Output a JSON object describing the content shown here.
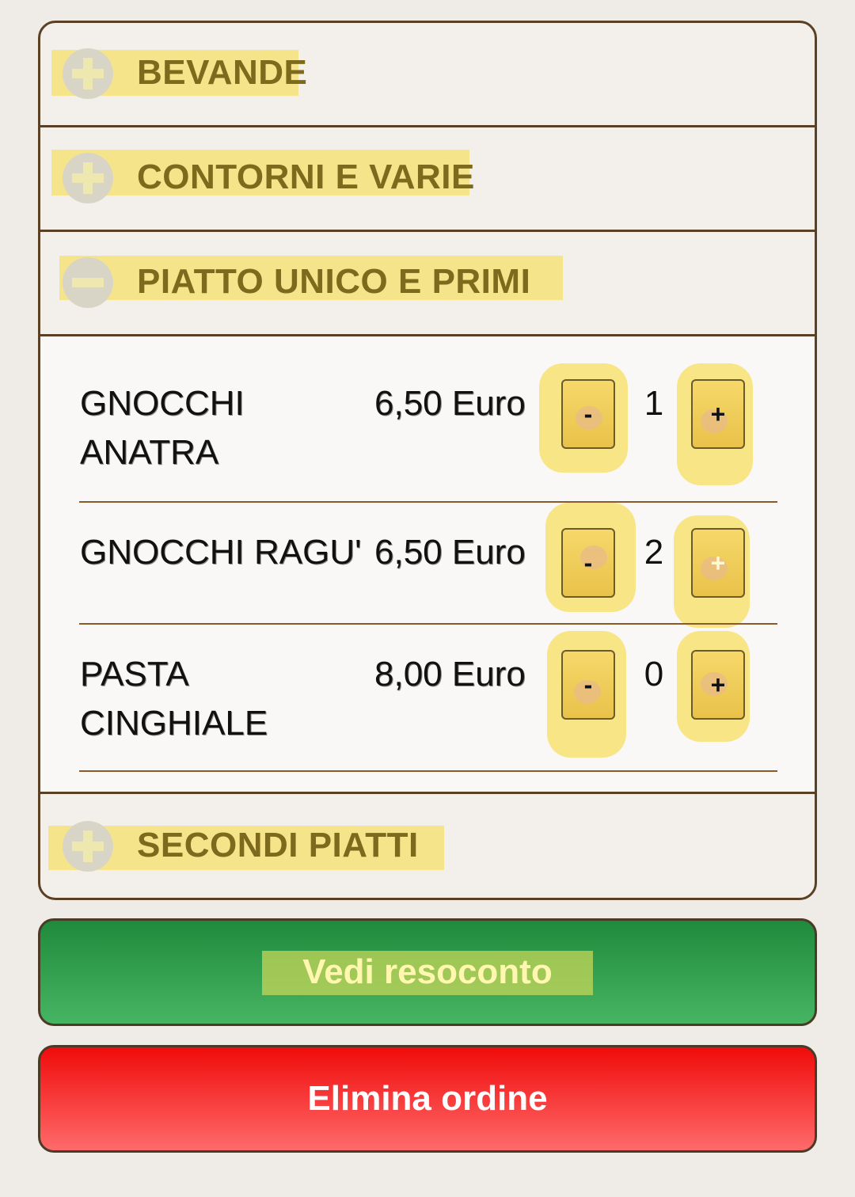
{
  "sections": [
    {
      "title": "BEVANDE",
      "state": "collapsed",
      "icon": "plus-icon"
    },
    {
      "title": "CONTORNI E VARIE",
      "state": "collapsed",
      "icon": "plus-icon"
    },
    {
      "title": "PIATTO UNICO E PRIMI",
      "state": "expanded",
      "icon": "minus-icon"
    },
    {
      "title": "SECONDI PIATTI",
      "state": "collapsed",
      "icon": "plus-icon"
    }
  ],
  "items": [
    {
      "name_line1": "GNOCCHI",
      "name_line2": "ANATRA",
      "price": "6,50 Euro",
      "qty": "1",
      "minus": "-",
      "plus": "+"
    },
    {
      "name_line1": "GNOCCHI RAGU'",
      "name_line2": "",
      "price": "6,50 Euro",
      "qty": "2",
      "minus": "-",
      "plus": "+"
    },
    {
      "name_line1": "PASTA",
      "name_line2": "CINGHIALE",
      "price": "8,00 Euro",
      "qty": "0",
      "minus": "-",
      "plus": "+"
    }
  ],
  "actions": {
    "summary_label": "Vedi resoconto",
    "delete_label": "Elimina ordine"
  },
  "colors": {
    "accent_title": "#7d6a1d",
    "summary_button": "#2e9a48",
    "delete_button": "#f51010",
    "border": "#5a4126"
  }
}
